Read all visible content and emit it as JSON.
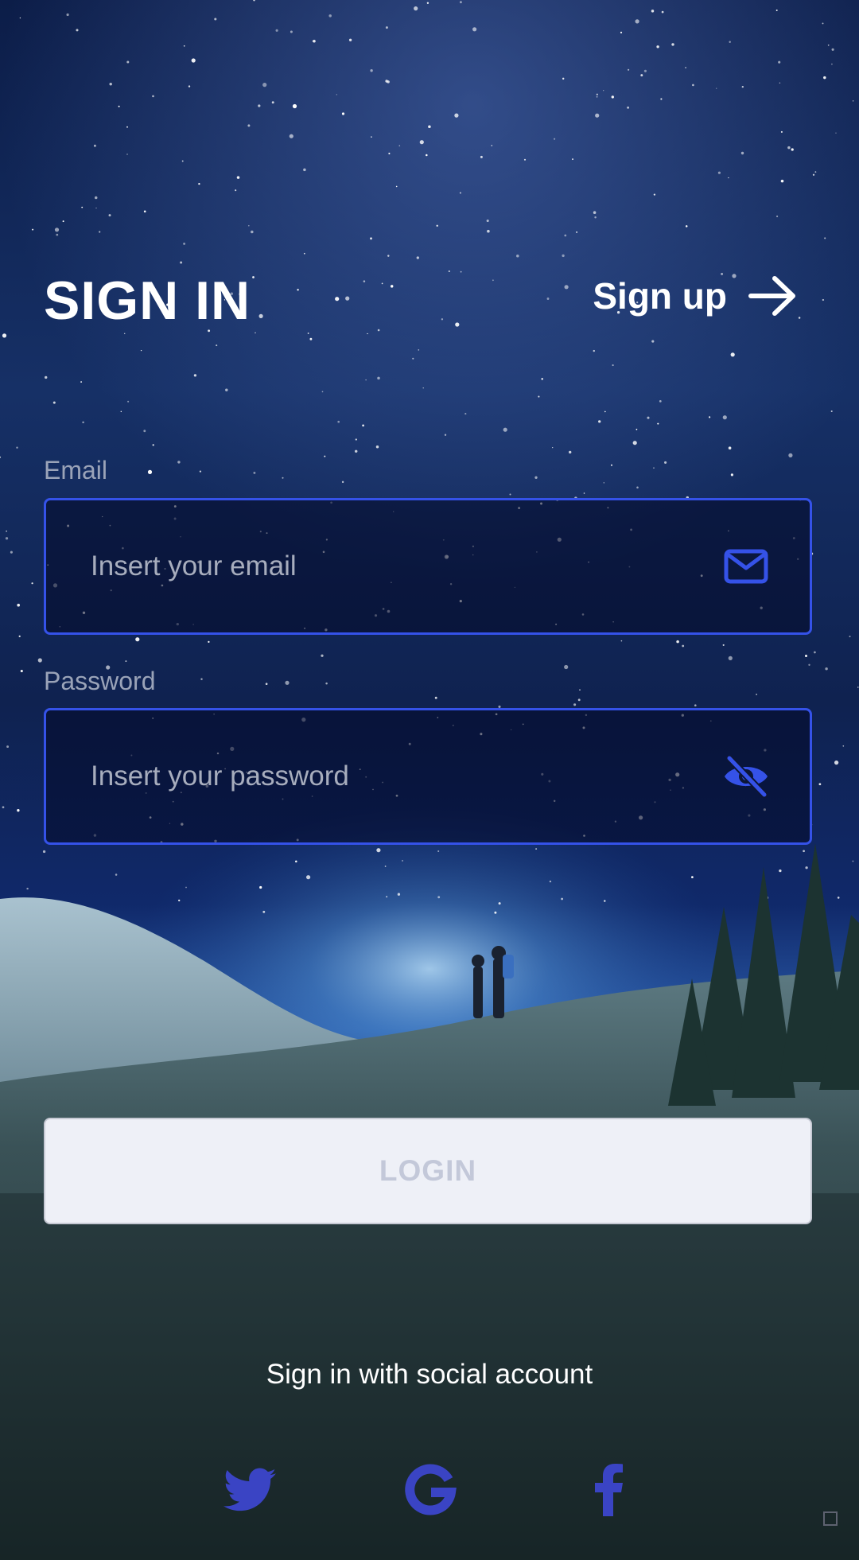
{
  "header": {
    "title": "SIGN IN",
    "signup_label": "Sign up"
  },
  "form": {
    "email": {
      "label": "Email",
      "placeholder": "Insert your email",
      "value": "",
      "icon": "mail-icon"
    },
    "password": {
      "label": "Password",
      "placeholder": "Insert your password",
      "value": "",
      "icon": "eye-off-icon"
    },
    "login_label": "LOGIN"
  },
  "social": {
    "label": "Sign in with social account",
    "providers": [
      "twitter-icon",
      "google-icon",
      "facebook-icon"
    ]
  },
  "colors": {
    "accent": "#3552e8",
    "social_icon": "#3a44c4",
    "login_bg": "#eef0f7",
    "login_text": "#c3c8d9"
  }
}
